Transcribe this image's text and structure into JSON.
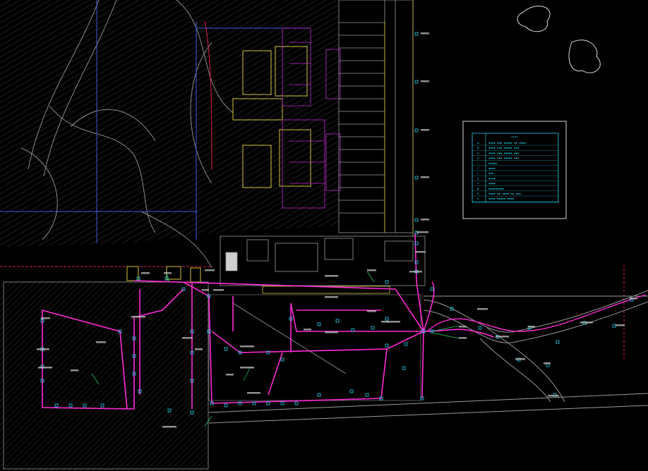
{
  "colors": {
    "background": "#000000",
    "cable": "#ff2bd6",
    "cyan": "#22d3ee",
    "green": "#22c55e",
    "yellow": "#d4c43a",
    "red": "#e11d48",
    "blue": "#3b5bdb",
    "grey": "#6b6b6b",
    "white": "#d9d9d9"
  },
  "drawing": {
    "type": "CAD site plan - power cable routing",
    "note": "All text labels in the source image are too small to read; they are rendered as unreadable placeholder glyph blocks."
  },
  "legend": {
    "title_glyph": "▭▭▭▭",
    "rows": [
      {
        "symbol": "⊞",
        "text": "▪▪▪▪ ▪▪▪ ▪▪▪▪▪ ▪▪ ▪▪▪▪"
      },
      {
        "symbol": "⊠",
        "text": "▪▪▪▪ ▪▪▪ ▪▪▪▪▪ ▪▪▪"
      },
      {
        "symbol": "⊡",
        "text": "▪▪▪▪ ▪▪▪ ▪▪▪▪▪ ▪▪▪"
      },
      {
        "symbol": "⊟",
        "text": "▪▪▪▪ ▪▪▪ ▪▪▪▪▪ ▪▪▪"
      },
      {
        "symbol": "—",
        "text": "▪▪▪▪▪"
      },
      {
        "symbol": "╱",
        "text": "▪▪▪▪"
      },
      {
        "symbol": "○",
        "text": "▪▪▪"
      },
      {
        "symbol": "◎",
        "text": "▪▪▪▪"
      },
      {
        "symbol": "▭",
        "text": "▪▪▪▪"
      },
      {
        "symbol": "▬",
        "text": "▪▪▪▪▪▪▪▪▪"
      },
      {
        "symbol": "⊕",
        "text": "▪▪▪▪ ▪▪ ▪▪▪▪ ▪▪ ▪▪▪"
      },
      {
        "symbol": "⊗",
        "text": "▪▪▪▪ ▪▪▪▪▪ ▪▪▪▪"
      }
    ]
  }
}
